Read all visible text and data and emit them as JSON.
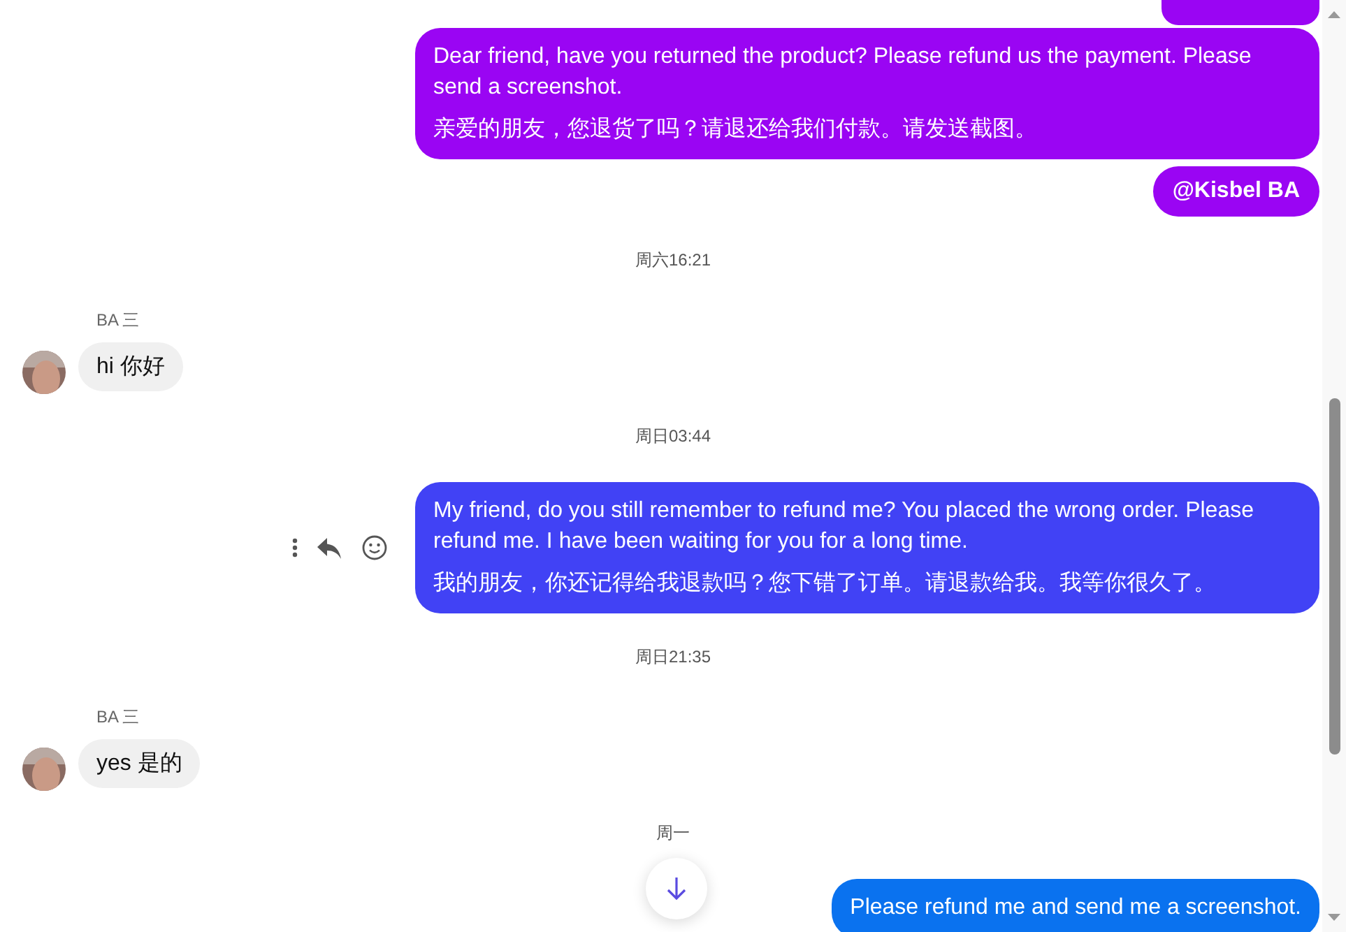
{
  "messages": [
    {
      "kind": "stub",
      "color": "#9a05f3"
    },
    {
      "kind": "outgoing",
      "color": "#9a05f3",
      "lines": [
        "Dear friend, have you returned the product? Please refund us the payment. Please send a screenshot.",
        "亲爱的朋友，您退货了吗？请退还给我们付款。请发送截图。"
      ],
      "show_actions": false
    },
    {
      "kind": "tag",
      "color": "#9a05f3",
      "text": "@Kisbel BA"
    },
    {
      "kind": "time",
      "text": "周六16:21"
    },
    {
      "kind": "incoming",
      "sender": "BA 三",
      "text": "hi  你好"
    },
    {
      "kind": "time",
      "text": "周日03:44"
    },
    {
      "kind": "outgoing",
      "color": "#4142f5",
      "lines": [
        "My friend, do you still remember to refund me? You placed the wrong order. Please refund me. I have been waiting for you for a long time.",
        "我的朋友，你还记得给我退款吗？您下错了订单。请退款给我。我等你很久了。"
      ],
      "show_actions": true
    },
    {
      "kind": "time",
      "text": "周日21:35"
    },
    {
      "kind": "incoming",
      "sender": "BA 三",
      "text": "yes  是的"
    },
    {
      "kind": "time",
      "text": "周一"
    },
    {
      "kind": "outgoing",
      "color": "#0a72ef",
      "lines": [
        "Please refund me and send me a screenshot."
      ],
      "show_actions": false
    }
  ]
}
